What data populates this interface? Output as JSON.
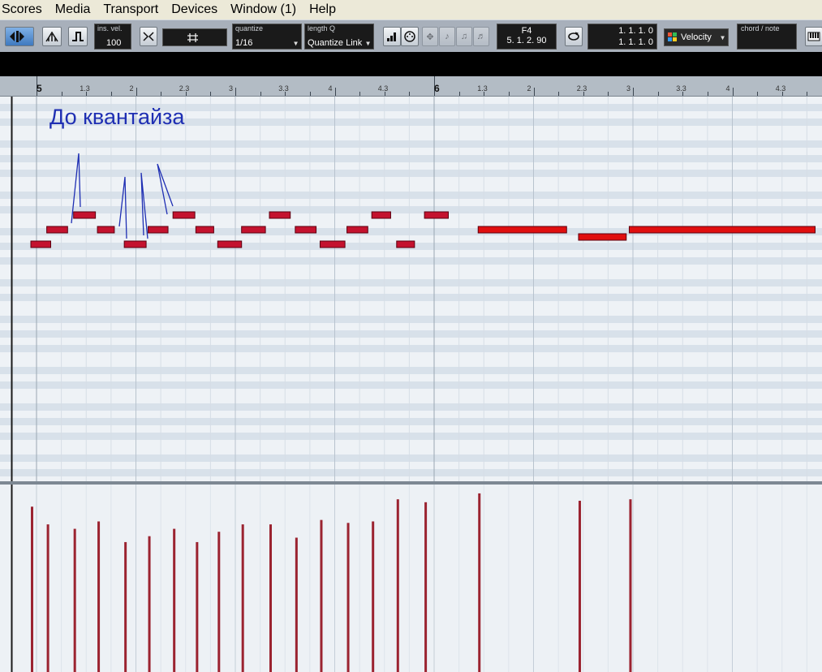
{
  "menu": [
    "Scores",
    "Media",
    "Transport",
    "Devices",
    "Window (1)",
    "Help"
  ],
  "toolbar": {
    "ins_vel_label": "ins. vel.",
    "ins_vel_value": "100",
    "quantize_label": "quantize",
    "quantize_value": "1/16",
    "length_label": "length Q",
    "length_value": "Quantize Link",
    "pitch_value": "F4",
    "position_value": "5. 1. 2. 90",
    "pos1": "1. 1. 1.   0",
    "pos2": "1. 1. 1.   0",
    "controller": "Velocity",
    "chord_label": "chord / note"
  },
  "ruler": {
    "labels": [
      {
        "text": "5",
        "big": true,
        "pos": 0
      },
      {
        "text": "1.3",
        "pos": 0.5
      },
      {
        "text": "2",
        "pos": 1
      },
      {
        "text": "2.3",
        "pos": 1.5
      },
      {
        "text": "3",
        "pos": 2
      },
      {
        "text": "3.3",
        "pos": 2.5
      },
      {
        "text": "4",
        "pos": 3
      },
      {
        "text": "4.3",
        "pos": 3.5
      },
      {
        "text": "6",
        "big": true,
        "pos": 4
      },
      {
        "text": "1.3",
        "pos": 4.5
      },
      {
        "text": "2",
        "pos": 5
      },
      {
        "text": "2.3",
        "pos": 5.5
      },
      {
        "text": "3",
        "pos": 6
      },
      {
        "text": "3.3",
        "pos": 6.5
      },
      {
        "text": "4",
        "pos": 7
      },
      {
        "text": "4.3",
        "pos": 7.5
      }
    ]
  },
  "editor": {
    "annotation": "До квантайза"
  },
  "colors": {
    "note_fill": "#c4122e",
    "note_long_fill": "#e00f0f",
    "velocity_bar": "#9b2330",
    "annotation": "#1f2fb3"
  },
  "chart_data": {
    "type": "piano-roll",
    "notes": [
      {
        "start": 0.0,
        "len": 0.2,
        "pitch": 0,
        "vel": 112
      },
      {
        "start": 0.16,
        "len": 0.21,
        "pitch": 1,
        "vel": 100
      },
      {
        "start": 0.43,
        "len": 0.22,
        "pitch": 2,
        "vel": 97
      },
      {
        "start": 0.67,
        "len": 0.17,
        "pitch": 1,
        "vel": 102
      },
      {
        "start": 0.94,
        "len": 0.22,
        "pitch": 0,
        "vel": 88
      },
      {
        "start": 1.18,
        "len": 0.2,
        "pitch": 1,
        "vel": 92
      },
      {
        "start": 1.43,
        "len": 0.22,
        "pitch": 2,
        "vel": 97
      },
      {
        "start": 1.66,
        "len": 0.18,
        "pitch": 1,
        "vel": 88
      },
      {
        "start": 1.88,
        "len": 0.24,
        "pitch": 0,
        "vel": 95
      },
      {
        "start": 2.12,
        "len": 0.24,
        "pitch": 1,
        "vel": 100
      },
      {
        "start": 2.4,
        "len": 0.21,
        "pitch": 2,
        "vel": 100
      },
      {
        "start": 2.66,
        "len": 0.21,
        "pitch": 1,
        "vel": 91
      },
      {
        "start": 2.91,
        "len": 0.25,
        "pitch": 0,
        "vel": 103
      },
      {
        "start": 3.18,
        "len": 0.21,
        "pitch": 1,
        "vel": 101
      },
      {
        "start": 3.43,
        "len": 0.19,
        "pitch": 2,
        "vel": 102
      },
      {
        "start": 3.68,
        "len": 0.18,
        "pitch": 0,
        "vel": 117
      },
      {
        "start": 3.96,
        "len": 0.24,
        "pitch": 2,
        "vel": 115
      },
      {
        "start": 4.5,
        "len": 0.89,
        "pitch": 1,
        "vel": 121
      },
      {
        "start": 5.51,
        "len": 0.48,
        "pitch": 0.5,
        "vel": 116
      },
      {
        "start": 6.02,
        "len": 1.87,
        "pitch": 1,
        "vel": 117
      }
    ]
  }
}
